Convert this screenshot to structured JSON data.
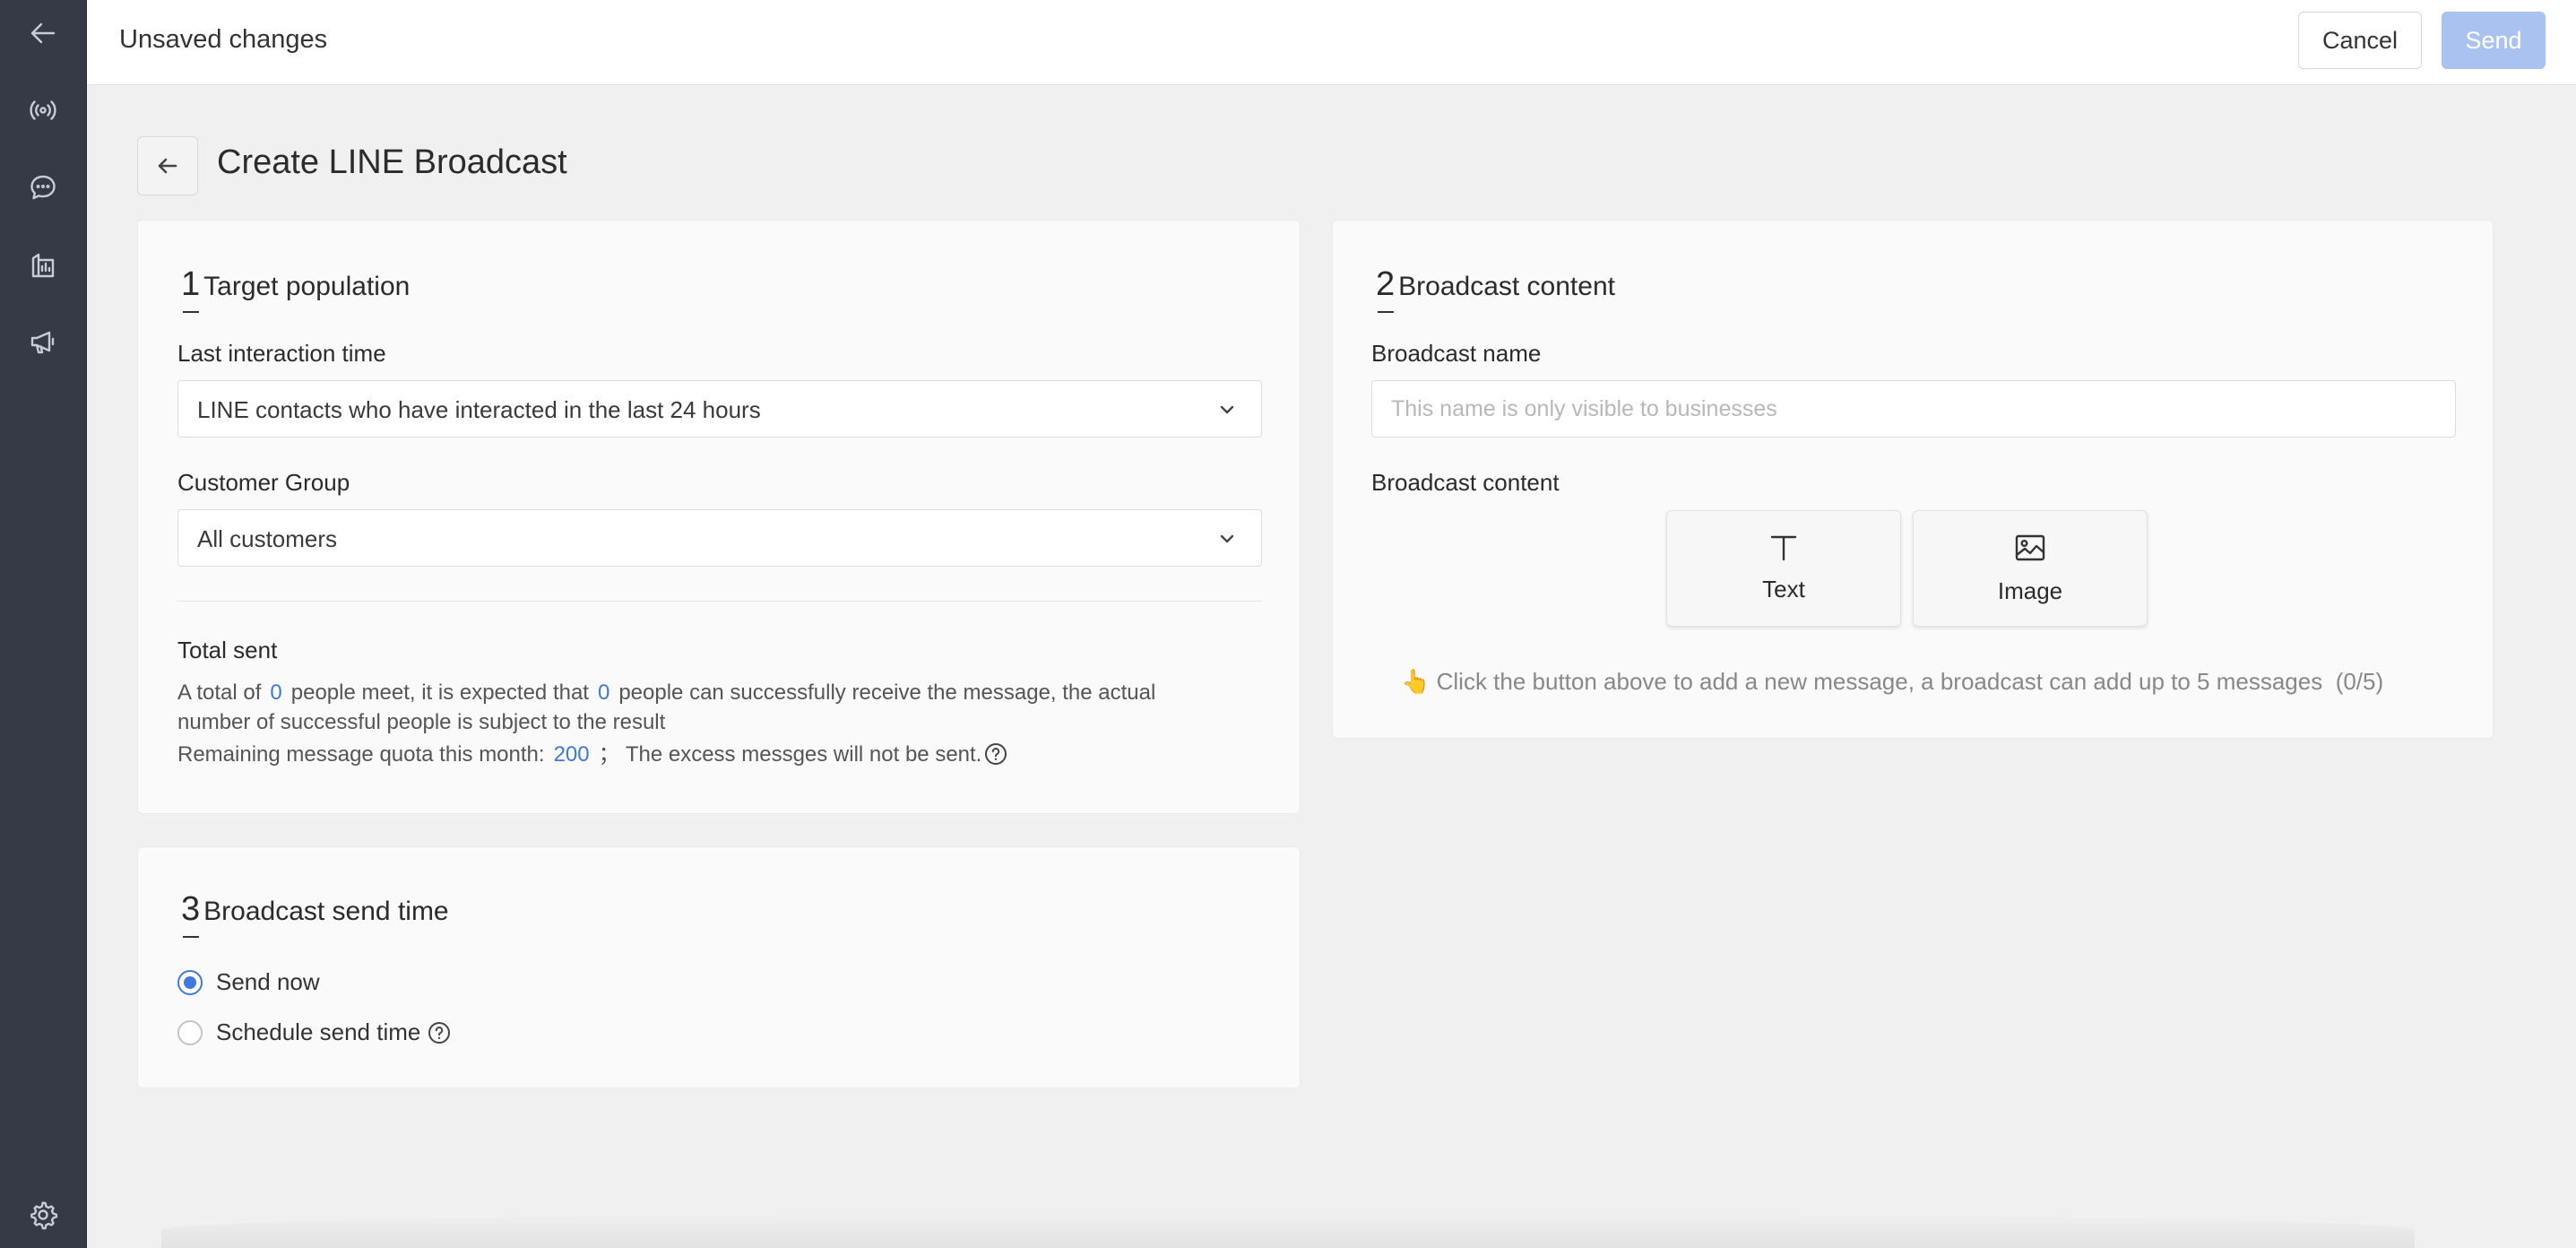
{
  "sidebar": {
    "items": [
      {
        "icon": "back-arrow-icon"
      },
      {
        "icon": "broadcast-icon"
      },
      {
        "icon": "chat-icon"
      },
      {
        "icon": "analytics-icon"
      },
      {
        "icon": "megaphone-icon"
      },
      {
        "icon": "settings-gear-icon"
      }
    ]
  },
  "topbar": {
    "title": "Unsaved changes",
    "cancel_label": "Cancel",
    "send_label": "Send"
  },
  "page": {
    "title": "Create LINE Broadcast"
  },
  "target": {
    "step": "1",
    "heading": "Target population",
    "interaction_label": "Last interaction time",
    "interaction_value": "LINE contacts who have interacted in the last 24 hours",
    "group_label": "Customer Group",
    "group_value": "All customers",
    "total_label": "Total sent",
    "line1_a": "A total of",
    "meet_count": "0",
    "line1_b": "people meet, it is expected that",
    "receive_count": "0",
    "line1_c": "people can successfully receive the message, the actual",
    "line2": "number of successful people is subject to the result",
    "quota_a": "Remaining message quota this month:",
    "quota_value": "200",
    "quota_b": "；  The excess messges will not be sent."
  },
  "content": {
    "step": "2",
    "heading": "Broadcast content",
    "name_label": "Broadcast name",
    "name_placeholder": "This name is only visible to businesses",
    "name_value": "",
    "content_label": "Broadcast content",
    "buttons": [
      {
        "label": "Text",
        "icon": "text-type-icon"
      },
      {
        "label": "Image",
        "icon": "image-icon"
      }
    ],
    "hint_emoji": "👆",
    "hint": "Click the button above to add a new message, a broadcast can add up to 5 messages",
    "hint_count": "(0/5)"
  },
  "sendtime": {
    "step": "3",
    "heading": "Broadcast send time",
    "options": [
      {
        "label": "Send now",
        "checked": true
      },
      {
        "label": "Schedule send time",
        "checked": false
      }
    ]
  },
  "colors": {
    "accent": "#3f78de",
    "send_disabled": "#a9c2ef",
    "sidebar": "#353a46"
  }
}
